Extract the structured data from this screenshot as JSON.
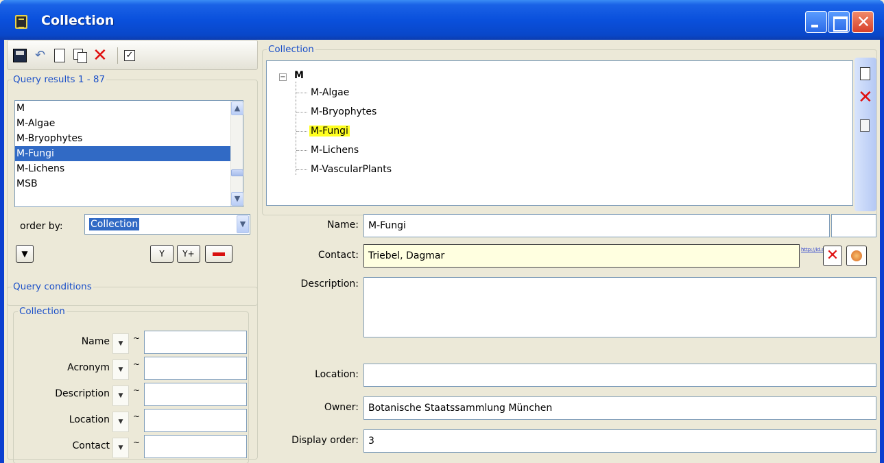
{
  "window": {
    "title": "Collection",
    "close_glyph": "✕"
  },
  "toolbar": {
    "icons": [
      "save-icon",
      "undo-icon",
      "new-document-icon",
      "copy-icon",
      "delete-icon",
      "check-icon"
    ],
    "check_glyph": "✓",
    "undo_glyph": "↶",
    "delete_glyph": "✕"
  },
  "query_results": {
    "legend": "Query results   1 - 87",
    "items": [
      "M",
      "M-Algae",
      "M-Bryophytes",
      "M-Fungi",
      "M-Lichens",
      "MSB"
    ],
    "selected_index": 3,
    "scroll_up": "▲",
    "scroll_down": "▼"
  },
  "order_by": {
    "label": "order by:",
    "value": "Collection",
    "arrow": "▼"
  },
  "buttons": {
    "expand_glyph": "▼",
    "filter_glyph": "Y",
    "filter_add_glyph": "Y+"
  },
  "query_conditions": {
    "legend": "Query conditions",
    "group_legend": "Collection",
    "op_glyph": "▼",
    "tilde": "~",
    "fields": [
      "Name",
      "Acronym",
      "Description",
      "Location",
      "Contact"
    ]
  },
  "collection": {
    "legend": "Collection",
    "tree": {
      "root": "M",
      "collapse_glyph": "−",
      "children": [
        "M-Algae",
        "M-Bryophytes",
        "M-Fungi",
        "M-Lichens",
        "M-VascularPlants"
      ],
      "selected_index": 2
    },
    "side_delete_glyph": "✕"
  },
  "details": {
    "name_label": "Name:",
    "name_value": "M-Fungi",
    "contact_label": "Contact:",
    "contact_value": "Triebel, Dagmar",
    "link_text": "http://id.s",
    "clear_glyph": "✕",
    "description_label": "Description:",
    "description_value": "",
    "location_label": "Location:",
    "location_value": "",
    "owner_label": "Owner:",
    "owner_value": "Botanische Staatssammlung München",
    "display_order_label": "Display order:",
    "display_order_value": "3"
  },
  "colors": {
    "titlebar": "#0a50dc",
    "selection": "#316ac5",
    "highlight": "#ffff20",
    "legend": "#1a4fc8",
    "delete": "#e01010"
  }
}
